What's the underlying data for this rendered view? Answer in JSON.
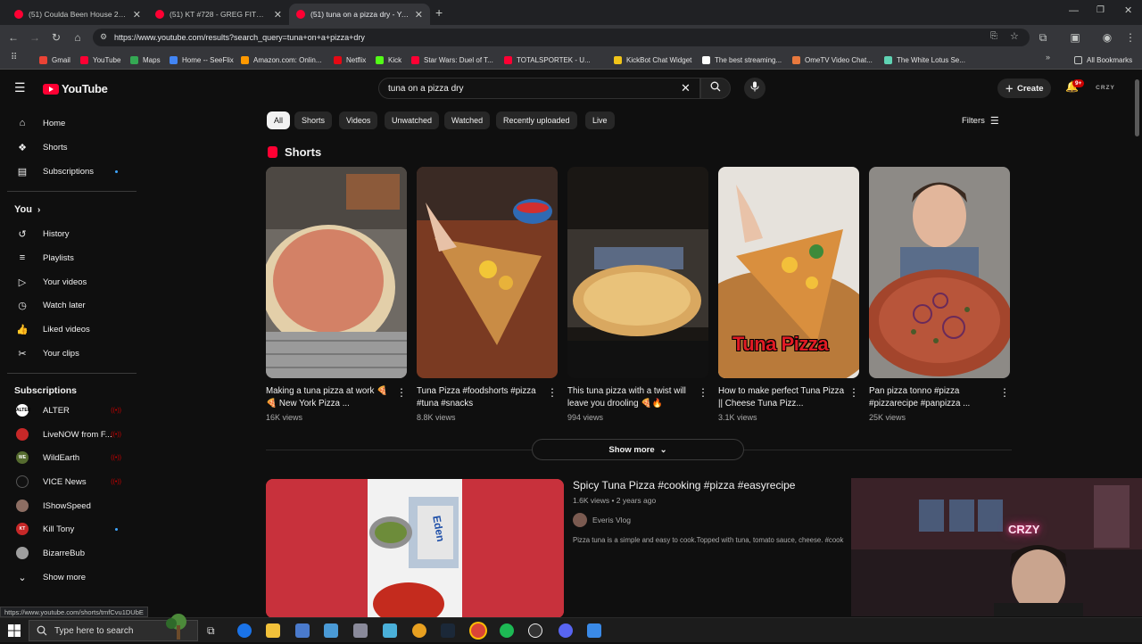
{
  "browser": {
    "tabs": [
      {
        "title": "(51) Coulda Been House 2, Epis"
      },
      {
        "title": "(51) KT #728 - GREG FITZSIMM"
      },
      {
        "title": "(51) tuna on a pizza dry - YouTu"
      }
    ],
    "new_tab": "+",
    "url": "https://www.youtube.com/results?search_query=tuna+on+a+pizza+dry",
    "bookmarks": [
      {
        "label": "Gmail",
        "color": "#ea4335"
      },
      {
        "label": "YouTube",
        "color": "#ff0033"
      },
      {
        "label": "Maps",
        "color": "#34a853"
      },
      {
        "label": "Home -- SeeFlix",
        "color": "#4285f4"
      },
      {
        "label": "Amazon.com: Onlin...",
        "color": "#ff9900"
      },
      {
        "label": "Netflix",
        "color": "#e50914"
      },
      {
        "label": "Kick",
        "color": "#53fc18"
      },
      {
        "label": "Star Wars: Duel of T...",
        "color": "#ff0033"
      },
      {
        "label": "TOTALSPORTEK - U...",
        "color": "#ff0033"
      },
      {
        "label": "KickBot Chat Widget",
        "color": "#f0c419"
      },
      {
        "label": "The best streaming...",
        "color": "#ffffff"
      },
      {
        "label": "OmeTV Video Chat...",
        "color": "#e8793e"
      },
      {
        "label": "The White Lotus Se...",
        "color": "#5fd3b3"
      }
    ],
    "all_bookmarks": "All Bookmarks"
  },
  "youtube": {
    "logo_text": "YouTube",
    "search_query": "tuna on a pizza dry",
    "create_label": "Create",
    "notif_badge": "9+",
    "avatar_text": "CRZY",
    "sidebar": {
      "main": [
        {
          "label": "Home",
          "icon": "home-icon"
        },
        {
          "label": "Shorts",
          "icon": "shorts-icon"
        },
        {
          "label": "Subscriptions",
          "icon": "subscriptions-icon"
        }
      ],
      "you_label": "You",
      "you_items": [
        {
          "label": "History"
        },
        {
          "label": "Playlists"
        },
        {
          "label": "Your videos"
        },
        {
          "label": "Watch later"
        },
        {
          "label": "Liked videos"
        },
        {
          "label": "Your clips"
        }
      ],
      "subscriptions_label": "Subscriptions",
      "subscriptions": [
        {
          "label": "ALTER",
          "color": "#ffffff",
          "text": "ALTER",
          "live": true
        },
        {
          "label": "LiveNOW from F...",
          "color": "#c62828",
          "text": "",
          "live": true
        },
        {
          "label": "WildEarth",
          "color": "#556b2f",
          "text": "WE",
          "live": true
        },
        {
          "label": "VICE News",
          "color": "#111111",
          "text": "",
          "live": true
        },
        {
          "label": "IShowSpeed",
          "color": "#8d6e63",
          "text": "",
          "live": false
        },
        {
          "label": "Kill Tony",
          "color": "#c62828",
          "text": "KT",
          "dot": true
        },
        {
          "label": "BizarreBub",
          "color": "#9e9e9e",
          "text": "",
          "live": false
        }
      ],
      "show_more": "Show more"
    },
    "chips": [
      "All",
      "Shorts",
      "Videos",
      "Unwatched",
      "Watched",
      "Recently uploaded",
      "Live"
    ],
    "filters_label": "Filters",
    "shorts_heading": "Shorts",
    "shorts": [
      {
        "title": "Making a tuna pizza at work 🍕🍕 New York Pizza ...",
        "views": "16K views"
      },
      {
        "title": "Tuna Pizza #foodshorts #pizza #tuna #snacks",
        "views": "8.8K views"
      },
      {
        "title": "This tuna pizza with a twist will leave you drooling 🍕🔥",
        "views": "994 views"
      },
      {
        "title": "How to make perfect Tuna Pizza || Cheese Tuna Pizz...",
        "views": "3.1K views",
        "overlay": "Tuna Pizza"
      },
      {
        "title": "Pan pizza tonno #pizza #pizzarecipe #panpizza ...",
        "views": "25K views"
      }
    ],
    "show_more_label": "Show more",
    "video": {
      "title": "Spicy Tuna Pizza #cooking #pizza #easyrecipe",
      "meta": "1.6K views • 2 years ago",
      "channel": "Everis Vlog",
      "description": "Pizza tuna is a simple and easy to cook.Topped with tuna, tomato sauce, cheese. #cook",
      "can_label": "Eden"
    },
    "webcam_sign": "CRZY"
  },
  "status_url": "https://www.youtube.com/shorts/tmfCvu1DUbE",
  "taskbar": {
    "search_placeholder": "Type here to search"
  }
}
